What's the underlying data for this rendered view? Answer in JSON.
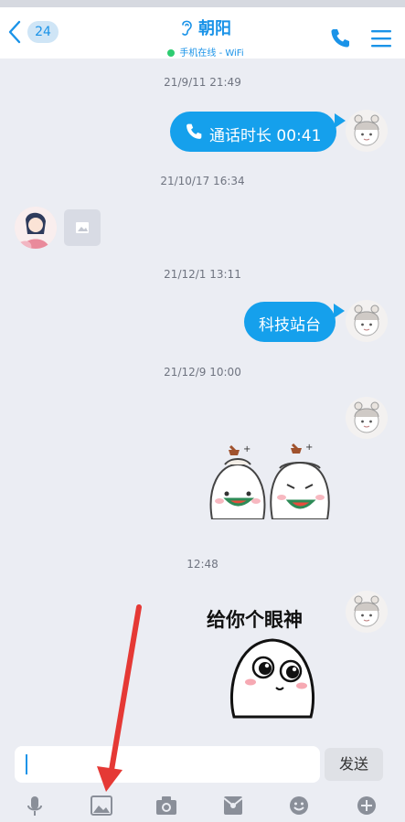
{
  "header": {
    "unread_count": "24",
    "contact_name": "朝阳",
    "status_text": "手机在线 - WiFi"
  },
  "messages": {
    "ts1": "21/9/11 21:49",
    "call_text": "通话时长 00:41",
    "ts2": "21/10/17 16:34",
    "ts3": "21/12/1 13:11",
    "text_message": "科技站台",
    "ts4": "21/12/9 10:00",
    "ts5": "12:48",
    "sticker_text": "给你个眼神"
  },
  "input": {
    "value": "",
    "send_label": "发送"
  },
  "colors": {
    "accent": "#1a93e8",
    "bubble": "#15a0ec",
    "background": "#ebedf3",
    "annotation_arrow": "#e53935"
  },
  "icons": [
    "back-icon",
    "ear-icon",
    "phone-icon",
    "menu-icon",
    "microphone-icon",
    "image-icon",
    "camera-icon",
    "red-packet-icon",
    "emoji-icon",
    "plus-icon"
  ]
}
